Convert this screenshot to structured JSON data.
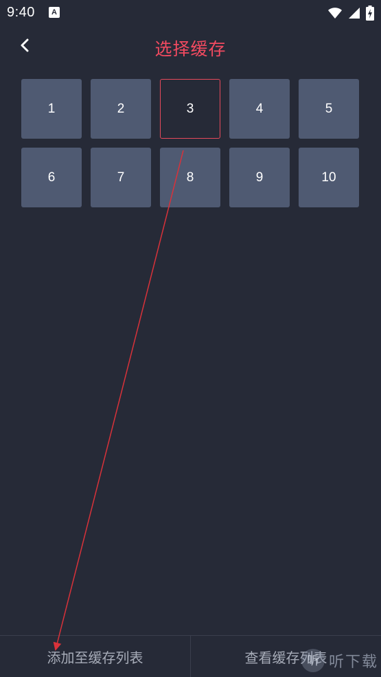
{
  "status_bar": {
    "time": "9:40",
    "notification_letter": "A",
    "icons": [
      "wifi-icon",
      "signal-icon",
      "battery-icon"
    ]
  },
  "header": {
    "title": "选择缓存",
    "back_icon": "back-arrow-icon"
  },
  "grid": {
    "cells": [
      "1",
      "2",
      "3",
      "4",
      "5",
      "6",
      "7",
      "8",
      "9",
      "10"
    ],
    "selected": "3"
  },
  "bottom_bar": {
    "add_label": "添加至缓存列表",
    "view_label": "查看缓存列表"
  },
  "watermark": {
    "logo_text": "听",
    "text": "听下载"
  },
  "colors": {
    "background": "#262a37",
    "accent": "#f24a60",
    "cell": "#4f5a72",
    "annotation_line": "#d9323a"
  }
}
